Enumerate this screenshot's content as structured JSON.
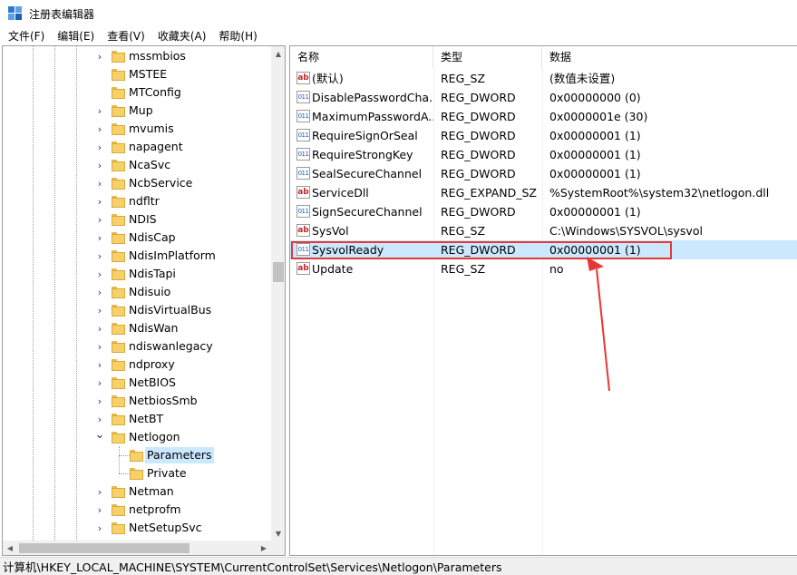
{
  "window": {
    "title": "注册表编辑器",
    "icon": "regedit-icon"
  },
  "menu": [
    {
      "label": "文件(F)"
    },
    {
      "label": "编辑(E)"
    },
    {
      "label": "查看(V)"
    },
    {
      "label": "收藏夹(A)"
    },
    {
      "label": "帮助(H)"
    }
  ],
  "tree": {
    "items": [
      {
        "label": "mssmbios",
        "expander": "collapsed",
        "level": 0
      },
      {
        "label": "MSTEE",
        "expander": "none",
        "level": 0
      },
      {
        "label": "MTConfig",
        "expander": "none",
        "level": 0
      },
      {
        "label": "Mup",
        "expander": "collapsed",
        "level": 0
      },
      {
        "label": "mvumis",
        "expander": "collapsed",
        "level": 0
      },
      {
        "label": "napagent",
        "expander": "collapsed",
        "level": 0
      },
      {
        "label": "NcaSvc",
        "expander": "collapsed",
        "level": 0
      },
      {
        "label": "NcbService",
        "expander": "collapsed",
        "level": 0
      },
      {
        "label": "ndfltr",
        "expander": "collapsed",
        "level": 0
      },
      {
        "label": "NDIS",
        "expander": "collapsed",
        "level": 0
      },
      {
        "label": "NdisCap",
        "expander": "collapsed",
        "level": 0
      },
      {
        "label": "NdisImPlatform",
        "expander": "collapsed",
        "level": 0
      },
      {
        "label": "NdisTapi",
        "expander": "collapsed",
        "level": 0
      },
      {
        "label": "Ndisuio",
        "expander": "collapsed",
        "level": 0
      },
      {
        "label": "NdisVirtualBus",
        "expander": "collapsed",
        "level": 0
      },
      {
        "label": "NdisWan",
        "expander": "collapsed",
        "level": 0
      },
      {
        "label": "ndiswanlegacy",
        "expander": "collapsed",
        "level": 0
      },
      {
        "label": "ndproxy",
        "expander": "collapsed",
        "level": 0
      },
      {
        "label": "NetBIOS",
        "expander": "collapsed",
        "level": 0
      },
      {
        "label": "NetbiosSmb",
        "expander": "collapsed",
        "level": 0
      },
      {
        "label": "NetBT",
        "expander": "collapsed",
        "level": 0
      },
      {
        "label": "Netlogon",
        "expander": "expanded",
        "level": 0
      },
      {
        "label": "Parameters",
        "expander": "none",
        "level": 1,
        "selected": true
      },
      {
        "label": "Private",
        "expander": "none",
        "level": 1
      },
      {
        "label": "Netman",
        "expander": "collapsed",
        "level": 0
      },
      {
        "label": "netprofm",
        "expander": "collapsed",
        "level": 0
      },
      {
        "label": "NetSetupSvc",
        "expander": "collapsed",
        "level": 0
      }
    ]
  },
  "list": {
    "columns": {
      "name": "名称",
      "type": "类型",
      "data": "数据"
    },
    "rows": [
      {
        "icon": "string-value-icon",
        "kind": "sz",
        "name": "(默认)",
        "type": "REG_SZ",
        "data": "(数值未设置)"
      },
      {
        "icon": "binary-value-icon",
        "kind": "bin",
        "name": "DisablePasswordCha...",
        "type": "REG_DWORD",
        "data": "0x00000000 (0)"
      },
      {
        "icon": "binary-value-icon",
        "kind": "bin",
        "name": "MaximumPasswordA...",
        "type": "REG_DWORD",
        "data": "0x0000001e (30)"
      },
      {
        "icon": "binary-value-icon",
        "kind": "bin",
        "name": "RequireSignOrSeal",
        "type": "REG_DWORD",
        "data": "0x00000001 (1)"
      },
      {
        "icon": "binary-value-icon",
        "kind": "bin",
        "name": "RequireStrongKey",
        "type": "REG_DWORD",
        "data": "0x00000001 (1)"
      },
      {
        "icon": "binary-value-icon",
        "kind": "bin",
        "name": "SealSecureChannel",
        "type": "REG_DWORD",
        "data": "0x00000001 (1)"
      },
      {
        "icon": "string-value-icon",
        "kind": "sz",
        "name": "ServiceDll",
        "type": "REG_EXPAND_SZ",
        "data": "%SystemRoot%\\system32\\netlogon.dll"
      },
      {
        "icon": "binary-value-icon",
        "kind": "bin",
        "name": "SignSecureChannel",
        "type": "REG_DWORD",
        "data": "0x00000001 (1)"
      },
      {
        "icon": "string-value-icon",
        "kind": "sz",
        "name": "SysVol",
        "type": "REG_SZ",
        "data": "C:\\Windows\\SYSVOL\\sysvol"
      },
      {
        "icon": "binary-value-icon",
        "kind": "bin",
        "name": "SysvolReady",
        "type": "REG_DWORD",
        "data": "0x00000001 (1)",
        "selected": true
      },
      {
        "icon": "string-value-icon",
        "kind": "sz",
        "name": "Update",
        "type": "REG_SZ",
        "data": "no"
      }
    ]
  },
  "status": {
    "path": "计算机\\HKEY_LOCAL_MACHINE\\SYSTEM\\CurrentControlSet\\Services\\Netlogon\\Parameters"
  },
  "annotation": {
    "color": "#e53935"
  },
  "colors": {
    "selection": "#cce8ff",
    "folder": "#f6d16a",
    "accent": "#2b78d4"
  }
}
